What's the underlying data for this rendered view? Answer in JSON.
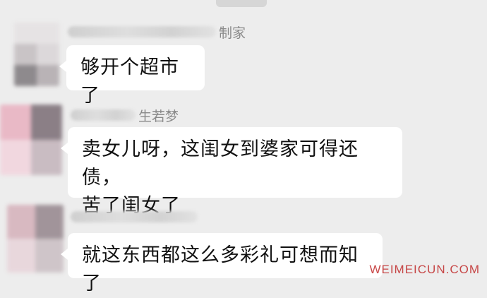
{
  "chat": {
    "messages": [
      {
        "sender_visible_suffix": "制家",
        "text_lines": [
          "够开个超市了"
        ]
      },
      {
        "sender_visible_suffix": "生若梦",
        "text_lines": [
          "卖女儿呀，这闺女到婆家可得还债，",
          "苦了闺女了"
        ]
      },
      {
        "sender_visible_suffix": "",
        "text_lines": [
          "就这东西都这么多彩礼可想而知了"
        ]
      }
    ]
  },
  "watermark": "WEIMEICUN.COM"
}
